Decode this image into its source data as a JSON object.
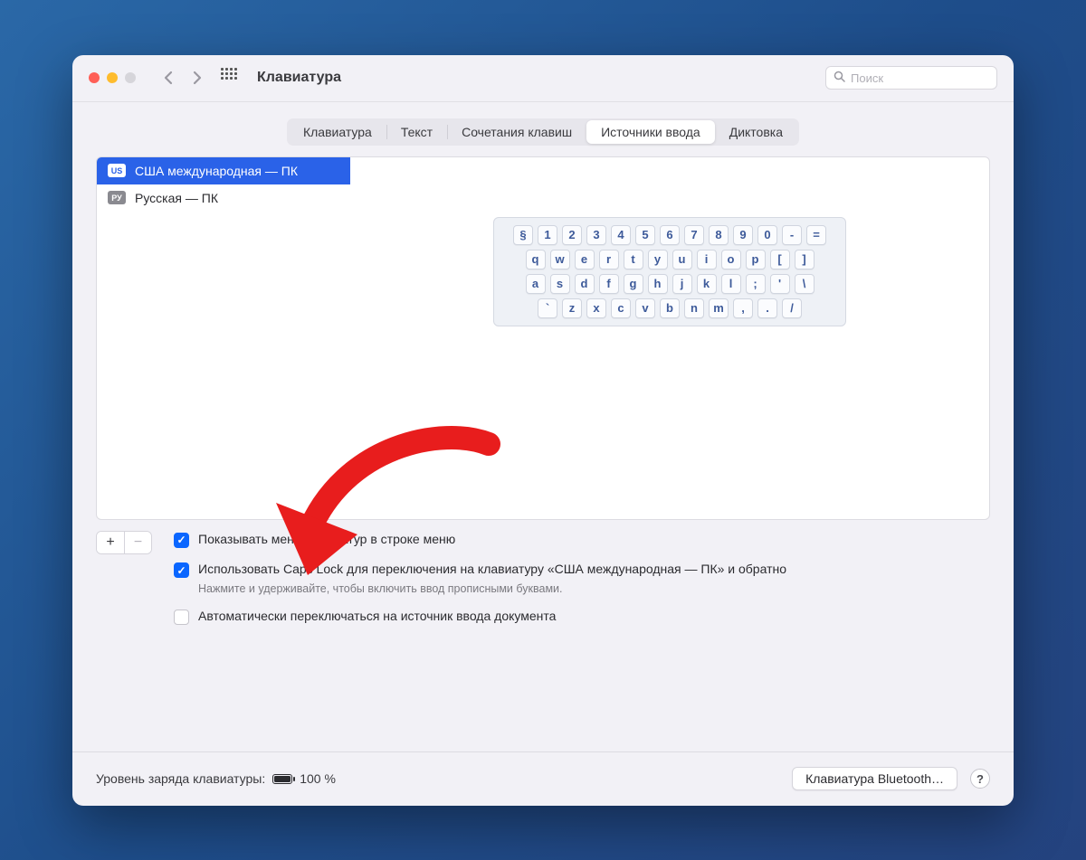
{
  "window": {
    "title": "Клавиатура"
  },
  "search": {
    "placeholder": "Поиск"
  },
  "tabs": [
    {
      "label": "Клавиатура"
    },
    {
      "label": "Текст"
    },
    {
      "label": "Сочетания клавиш"
    },
    {
      "label": "Источники ввода"
    },
    {
      "label": "Диктовка"
    }
  ],
  "active_tab": 3,
  "input_sources": [
    {
      "code": "US",
      "label": "США международная — ПК",
      "selected": true
    },
    {
      "code": "РУ",
      "label": "Русская — ПК",
      "selected": false
    }
  ],
  "keyboard_preview": {
    "row1": [
      "§",
      "1",
      "2",
      "3",
      "4",
      "5",
      "6",
      "7",
      "8",
      "9",
      "0",
      "-",
      "="
    ],
    "row2": [
      "q",
      "w",
      "e",
      "r",
      "t",
      "y",
      "u",
      "i",
      "o",
      "p",
      "[",
      "]"
    ],
    "row3": [
      "a",
      "s",
      "d",
      "f",
      "g",
      "h",
      "j",
      "k",
      "l",
      ";",
      "'",
      "\\"
    ],
    "row4": [
      "`",
      "z",
      "x",
      "c",
      "v",
      "b",
      "n",
      "m",
      ",",
      ".",
      "/"
    ]
  },
  "options": {
    "show_menu": {
      "checked": true,
      "label": "Показывать меню клавиатур в строке меню"
    },
    "caps_lock": {
      "checked": true,
      "label": "Использовать Caps Lock для переключения на клавиатуру «США международная — ПК» и обратно",
      "hint": "Нажмите и удерживайте, чтобы включить ввод прописными буквами."
    },
    "auto_switch": {
      "checked": false,
      "label": "Автоматически переключаться на источник ввода документа"
    }
  },
  "footer": {
    "battery_label": "Уровень заряда клавиатуры:",
    "battery_percent": "100 %",
    "bluetooth_button": "Клавиатура Bluetooth…"
  }
}
